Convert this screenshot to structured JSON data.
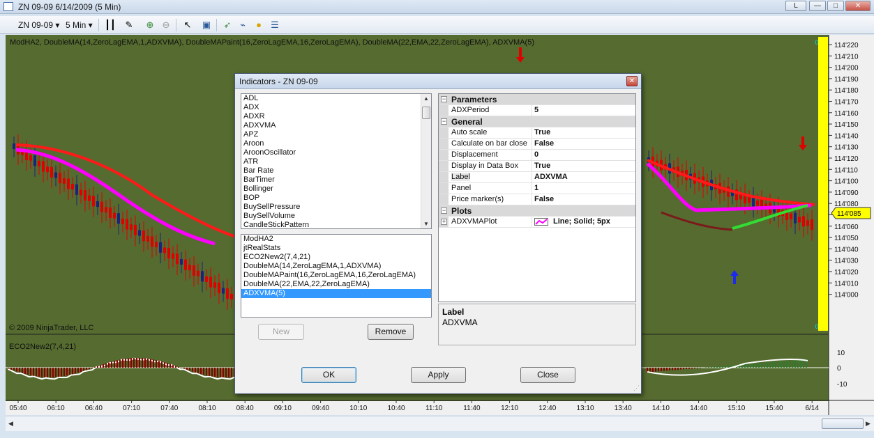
{
  "window": {
    "title": "ZN 09-09  6/14/2009 (5 Min)",
    "btn_l": "L",
    "btn_min": "—",
    "btn_max": "□",
    "btn_close": "✕"
  },
  "toolbar": {
    "instrument": "ZN 09-09",
    "interval": "5 Min"
  },
  "chart": {
    "indicator_label": "ModHA2, DoubleMA(14,ZeroLagEMA,1,ADXVMA), DoubleMAPaint(16,ZeroLagEMA,16,ZeroLagEMA), DoubleMA(22,EMA,22,ZeroLagEMA), ADXVMA(5)",
    "copyright": "© 2009 NinjaTrader, LLC",
    "lower_label": "ECO2New2(7,4,21)",
    "price_ticks": [
      "114'220",
      "114'210",
      "114'200",
      "114'190",
      "114'180",
      "114'170",
      "114'160",
      "114'150",
      "114'140",
      "114'130",
      "114'120",
      "114'110",
      "114'100",
      "114'090",
      "114'080",
      "114'070",
      "114'060",
      "114'050",
      "114'040",
      "114'030",
      "114'020",
      "114'010",
      "114'000"
    ],
    "current_price": "114'085",
    "scale_top": "0",
    "scale_bottom": "0",
    "lower_ticks": [
      "10",
      "0",
      "-10"
    ],
    "time_ticks": [
      "05:40",
      "06:10",
      "06:40",
      "07:10",
      "07:40",
      "08:10",
      "08:40",
      "09:10",
      "09:40",
      "10:10",
      "10:40",
      "11:10",
      "11:40",
      "12:10",
      "12:40",
      "13:10",
      "13:40",
      "14:10",
      "14:40",
      "15:10",
      "15:40",
      "6/14"
    ]
  },
  "dialog": {
    "title": "Indicators - ZN 09-09",
    "available": [
      "ADL",
      "ADX",
      "ADXR",
      "ADXVMA",
      "APZ",
      "Aroon",
      "AroonOscillator",
      "ATR",
      "Bar Rate",
      "BarTimer",
      "Bollinger",
      "BOP",
      "BuySellPressure",
      "BuySellVolume",
      "CandleStickPattern"
    ],
    "applied": [
      "ModHA2",
      "jtRealStats",
      "ECO2New2(7,4,21)",
      "DoubleMA(14,ZeroLagEMA,1,ADXVMA)",
      "DoubleMAPaint(16,ZeroLagEMA,16,ZeroLagEMA)",
      "DoubleMA(22,EMA,22,ZeroLagEMA)",
      "ADXVMA(5)"
    ],
    "new_label": "New",
    "remove_label": "Remove",
    "properties": {
      "cat_parameters": "Parameters",
      "adxperiod_name": "ADXPeriod",
      "adxperiod_value": "5",
      "cat_general": "General",
      "autoscale_name": "Auto scale",
      "autoscale_value": "True",
      "calc_name": "Calculate on bar close",
      "calc_value": "False",
      "disp_name": "Displacement",
      "disp_value": "0",
      "databox_name": "Display in Data Box",
      "databox_value": "True",
      "label_name": "Label",
      "label_value": "ADXVMA",
      "panel_name": "Panel",
      "panel_value": "1",
      "pricemarker_name": "Price marker(s)",
      "pricemarker_value": "False",
      "cat_plots": "Plots",
      "plot_name": "ADXVMAPlot",
      "plot_value": "Line; Solid; 5px"
    },
    "desc_title": "Label",
    "desc_text": "ADXVMA",
    "ok_label": "OK",
    "apply_label": "Apply",
    "close_label": "Close"
  },
  "colors": {
    "chart_bg": "#556b2f",
    "up_bar": "#1a237e",
    "down_bar": "#e00000",
    "magenta_ma": "#ff00ff",
    "red_ma": "#ff1a1a",
    "scale_bar": "#ffff00"
  }
}
